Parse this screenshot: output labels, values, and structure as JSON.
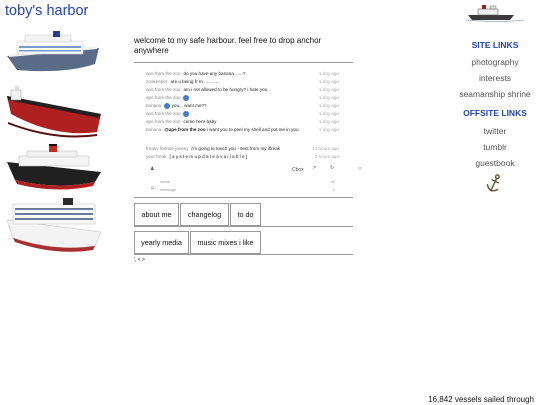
{
  "site": {
    "title": "toby's harbor",
    "welcome": "welcome to my safe harbour. feel free to drop anchor anywhere"
  },
  "ships": [
    {
      "name": "white cruise ship",
      "hull": "#5a6c88"
    },
    {
      "name": "red cargo ship",
      "hull": "#b02020"
    },
    {
      "name": "ocean liner",
      "hull": "#202020"
    },
    {
      "name": "large cruise ship",
      "hull": "#a83030"
    }
  ],
  "chat": {
    "messages": [
      {
        "name": "ape from the zoo",
        "text": "do you have any banana.......?",
        "time": "1 day ago"
      },
      {
        "name": "zookeeper",
        "text": "are u being fr rn.............",
        "time": "1 day ago"
      },
      {
        "name": "ape from the zoo",
        "text": "am i not allowed to be hungry? i hate you",
        "time": "1 day ago"
      },
      {
        "name": "ape from the zoo",
        "text": "",
        "time": "1 day ago",
        "smiley": true
      },
      {
        "name": "banana",
        "text": "you... want me??",
        "time": "1 day ago",
        "smiley_before": true
      },
      {
        "name": "ape from the zoo",
        "text": "",
        "time": "1 day ago",
        "smiley": true
      },
      {
        "name": "ape from the zoo",
        "text": "come here baby",
        "time": "1 day ago"
      },
      {
        "name": "banana",
        "text": "@ape from the zoo",
        "text2": "i want you to peel my shell and put me in you",
        "time": "1 day ago"
      },
      {
        "name": "freaky fortnite jonesy",
        "text": "i'm going to touch you - sent from my iflreak",
        "time": "12 hours ago"
      },
      {
        "name": "your freak",
        "text": "[ a y s t e m u p d a t e a v a i l a b l e ]",
        "time": "3 hours ago"
      }
    ],
    "cbox_label": "Cbox",
    "name_placeholder": "name",
    "message_placeholder": "message",
    "name_count": "40",
    "message_count": "1"
  },
  "nav_row1": [
    "about me",
    "changelog",
    "to do"
  ],
  "nav_row2": [
    "yearly media",
    "music mixes i like"
  ],
  "footnote": "', < >",
  "sidebar": {
    "site_links_heading": "SITE LINKS",
    "site_links": [
      "photography",
      "interests",
      "seamanship shrine"
    ],
    "offsite_links_heading": "OFFSITE LINKS",
    "offsite_links": [
      "twitter",
      "tumblr",
      "guestbook"
    ]
  },
  "counter": "16,842 vessels sailed through",
  "colors": {
    "accent": "#2244aa",
    "border": "#999999",
    "smiley": "#3c7bd0"
  }
}
